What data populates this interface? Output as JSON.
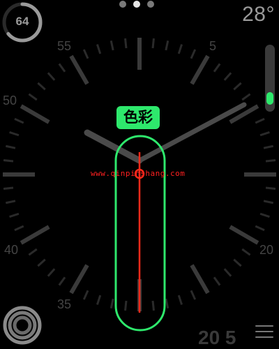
{
  "pager": {
    "pages": 3,
    "active_index": 1
  },
  "complications": {
    "battery": {
      "value": "64",
      "level": 0.64,
      "color": "#9a9a9a"
    },
    "temperature": {
      "value": "28°"
    },
    "activity_rings": {
      "colors": [
        "#8a8a8a",
        "#7a7a7a",
        "#6a6a6a"
      ]
    }
  },
  "dial": {
    "numerals": [
      {
        "text": "55"
      },
      {
        "text": "5"
      },
      {
        "text": "50"
      },
      {
        "text": "40"
      },
      {
        "text": "20"
      },
      {
        "text": "35"
      }
    ]
  },
  "customization": {
    "label": "色彩",
    "accent_color": "#2ee86c",
    "second_hand_color": "#ff2a1a",
    "scroll_position": 0.85
  },
  "watermark": {
    "text": "www.qinpinshang.com"
  },
  "bottom": {
    "partial_time": "20  5"
  },
  "icons": [
    "battery-ring-icon",
    "activity-rings-icon",
    "menu-icon",
    "digital-crown-indicator"
  ]
}
